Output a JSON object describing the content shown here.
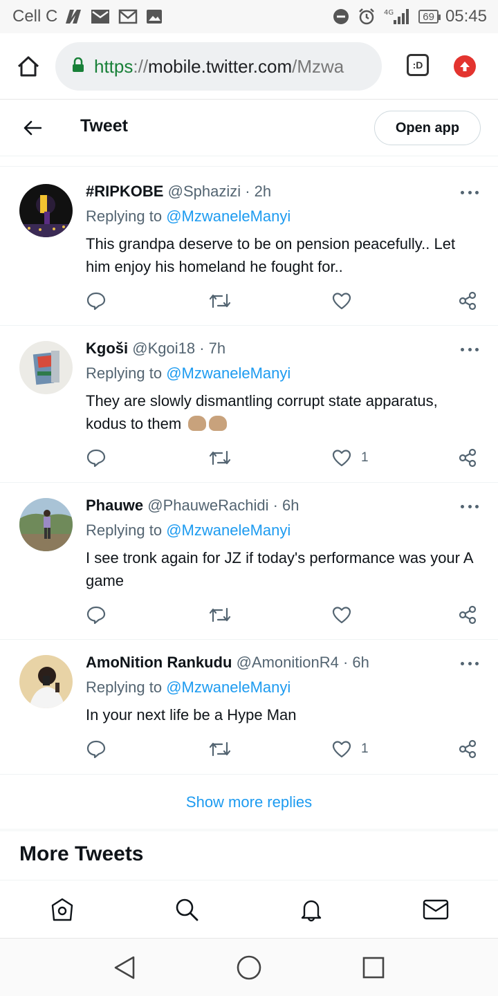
{
  "status_bar": {
    "carrier": "Cell C",
    "battery": "69",
    "time": "05:45",
    "network_type": "4G"
  },
  "browser": {
    "url_scheme": "https",
    "url_sep": "://",
    "url_host": "mobile.twitter.com",
    "url_path": "/Mzwa",
    "tabs_label": ":D"
  },
  "header": {
    "title": "Tweet",
    "open_app_label": "Open app"
  },
  "replies": [
    {
      "name": "#RIPKOBE",
      "handle": "@Sphazizi",
      "time": "· 2h",
      "replying_prefix": "Replying to",
      "replying_to": "@MzwaneleManyi",
      "text": "This grandpa deserve to be on pension peacefully.. Let him enjoy his homeland he fought for..",
      "likes": ""
    },
    {
      "name": "Kgoši",
      "handle": "@Kgoi18",
      "time": "· 7h",
      "replying_prefix": "Replying to",
      "replying_to": "@MzwaneleManyi",
      "text": "They are slowly dismantling corrupt state apparatus, kodus to them",
      "likes": "1"
    },
    {
      "name": "Phauwe",
      "handle": "@PhauweRachidi",
      "time": "· 6h",
      "replying_prefix": "Replying to",
      "replying_to": "@MzwaneleManyi",
      "text": "I see tronk again for JZ  if today's performance was your A game",
      "likes": ""
    },
    {
      "name": "AmoNition Rankudu",
      "handle": "@AmonitionR4",
      "time": "· 6h",
      "replying_prefix": "Replying to",
      "replying_to": "@MzwaneleManyi",
      "text": "In your next life be a Hype Man",
      "likes": "1"
    }
  ],
  "show_more_label": "Show more replies",
  "more_tweets_title": "More Tweets",
  "colors": {
    "accent": "#1d9bf0",
    "text_primary": "#0f1419",
    "text_secondary": "#536471",
    "secure_green": "#188038"
  }
}
